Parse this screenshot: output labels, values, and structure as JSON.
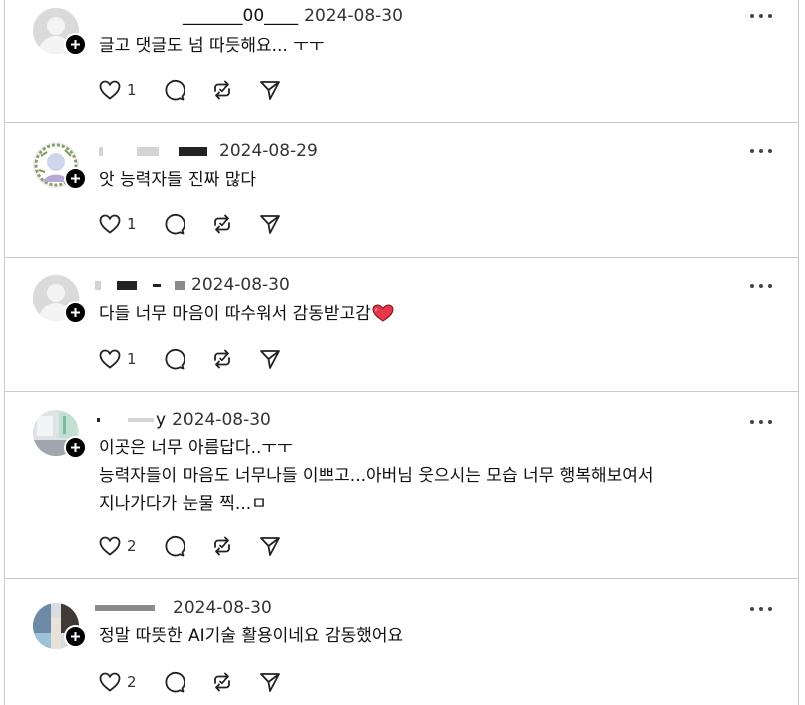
{
  "comments": [
    {
      "username": "_______00____",
      "date": "2024-08-30",
      "text": "글고 댓글도 넘 따듯해요... ㅜㅜ",
      "likes": "1",
      "avatar_icon": "default-avatar-icon"
    },
    {
      "username": "",
      "date": "2024-08-29",
      "text": "앗 능력자들 진짜 많다",
      "likes": "1",
      "avatar_icon": "photo-avatar-icon"
    },
    {
      "username": "",
      "date": "2024-08-30",
      "text": "다들 너무 마음이 따수워서 감동받고감",
      "likes": "1",
      "avatar_icon": "default-avatar-icon",
      "emoji": "heart-emoji-icon"
    },
    {
      "username": "y",
      "date": "2024-08-30",
      "text": "이곳은 너무 아름답다..ㅜㅜ\n능력자들이 마음도 너무나들 이쁘고...아버님 웃으시는 모습 너무 행복해보여서\n지나가다가 눈물 찍...ㅁ",
      "likes": "2",
      "avatar_icon": "photo-avatar-icon"
    },
    {
      "username": "",
      "date": "2024-08-30",
      "text": "정말 따뜻한 AI기술 활용이네요 감동했어요",
      "likes": "2",
      "avatar_icon": "photo-avatar-icon"
    }
  ],
  "icons": {
    "like": "heart-icon",
    "reply": "comment-bubble-icon",
    "repost": "repost-icon",
    "share": "send-icon",
    "more": "more-options-icon",
    "follow": "plus-icon"
  },
  "colors": {
    "accent_heart": "#e8364a",
    "separator": "#c9c9c9"
  }
}
